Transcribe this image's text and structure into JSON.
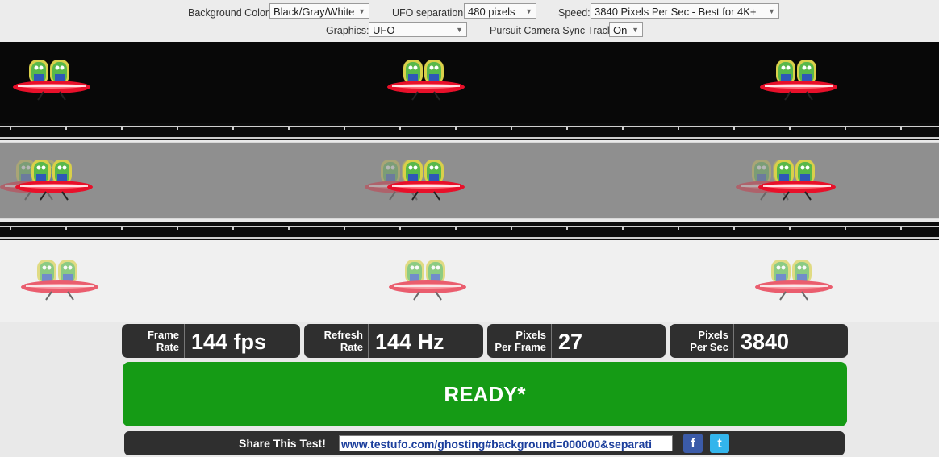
{
  "controls": {
    "background_label": "Background Color:",
    "background_value": "Black/Gray/White",
    "separation_label": "UFO separation:",
    "separation_value": "480 pixels",
    "speed_label": "Speed:",
    "speed_value": "3840 Pixels Per Sec - Best for 4K+",
    "graphics_label": "Graphics:",
    "graphics_value": "UFO",
    "sync_label": "Pursuit Camera Sync Track:",
    "sync_value": "On"
  },
  "stats": {
    "frame_rate_label_1": "Frame",
    "frame_rate_label_2": "Rate",
    "frame_rate_value": "144 fps",
    "refresh_rate_label_1": "Refresh",
    "refresh_rate_label_2": "Rate",
    "refresh_rate_value": "144 Hz",
    "ppf_label_1": "Pixels",
    "ppf_label_2": "Per Frame",
    "ppf_value": "27",
    "pps_label_1": "Pixels",
    "pps_label_2": "Per Sec",
    "pps_value": "3840"
  },
  "status": "READY*",
  "share": {
    "label": "Share This Test!",
    "url": "www.testufo.com/ghosting#background=000000&separati"
  },
  "social": {
    "facebook_glyph": "f",
    "twitter_glyph": "t"
  },
  "colors": {
    "ready_green": "#159b15",
    "panel_dark": "#2f2f2f",
    "ufo_red": "#e8102a",
    "alien_green": "#58b84a",
    "dome_yellow": "#d9d04a"
  }
}
